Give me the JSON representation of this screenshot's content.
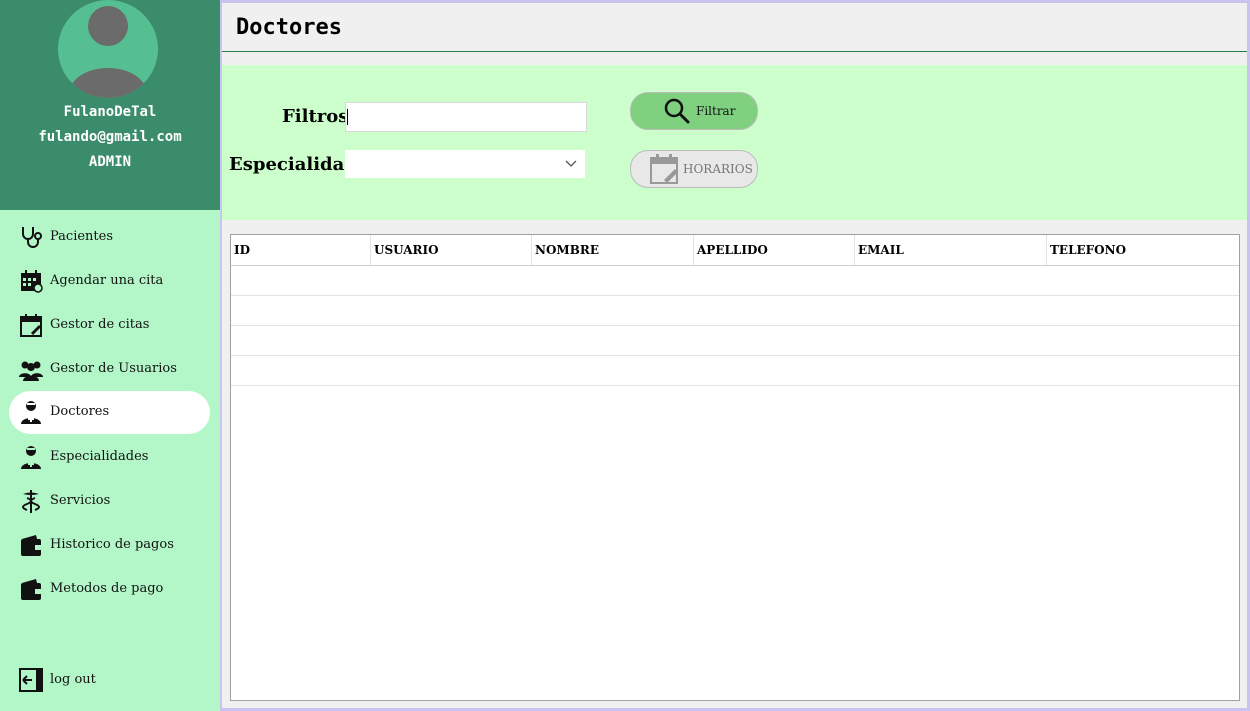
{
  "sidebar": {
    "user": {
      "name": "FulanoDeTal",
      "email": "fulando@gmail.com",
      "role": "ADMIN"
    },
    "items": [
      {
        "label": "Pacientes",
        "icon": "stethoscope-icon"
      },
      {
        "label": "Agendar una cita",
        "icon": "calendar-icon"
      },
      {
        "label": "Gestor de citas",
        "icon": "calendar-edit-icon"
      },
      {
        "label": "Gestor de Usuarios",
        "icon": "users-icon"
      },
      {
        "label": "Doctores",
        "icon": "doctor-icon",
        "active": true
      },
      {
        "label": "Especialidades",
        "icon": "doctor-specialty-icon"
      },
      {
        "label": "Servicios",
        "icon": "caduceus-icon"
      },
      {
        "label": "Historico de pagos",
        "icon": "wallet-icon"
      },
      {
        "label": "Metodos de pago",
        "icon": "wallet-icon"
      }
    ],
    "logout": "log out"
  },
  "main": {
    "title": "Doctores",
    "filters_label": "Filtros:",
    "filters_value": "",
    "specialty_label": "Especialidad:",
    "specialty_value": "",
    "filter_button": "Filtrar",
    "schedule_button": "HORARIOS"
  },
  "table": {
    "columns": [
      "ID",
      "USUARIO",
      "NOMBRE",
      "APELLIDO",
      "EMAIL",
      "TELEFONO"
    ],
    "rows": []
  },
  "colors": {
    "profile_bg": "#3b8c6b",
    "sidebar_bg": "#b3f7c9",
    "filter_panel_bg": "#ccffcc",
    "filter_button_bg": "#7fd07f"
  }
}
